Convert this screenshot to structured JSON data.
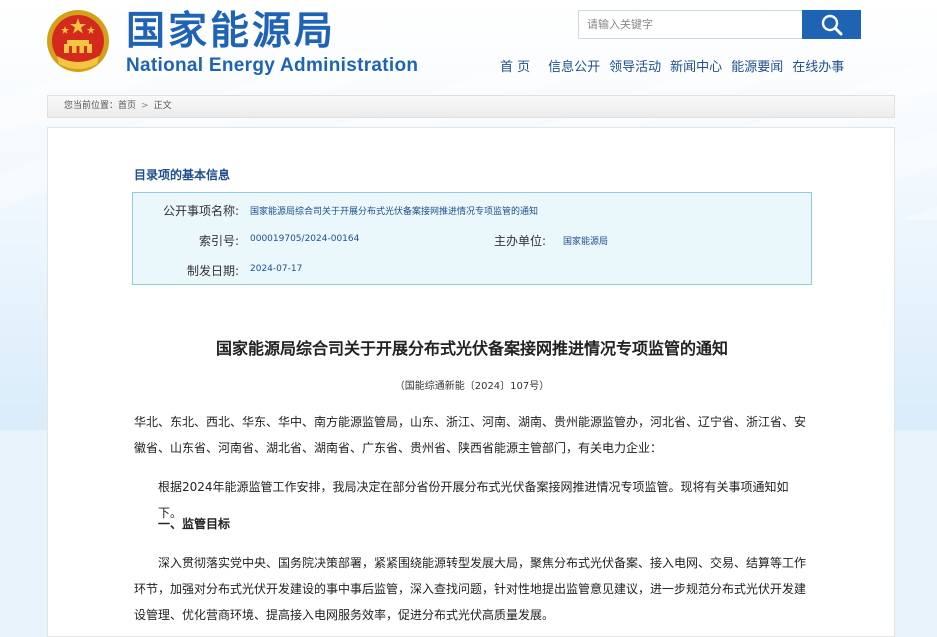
{
  "header": {
    "logo_cn": "国家能源局",
    "logo_en": "National Energy Administration",
    "search_placeholder": "请输入关键字"
  },
  "nav": {
    "items": [
      "首 页",
      "信息公开",
      "领导活动",
      "新闻中心",
      "能源要闻",
      "在线办事"
    ]
  },
  "breadcrumb": {
    "prefix": "您当前位置：",
    "home": "首页",
    "separator": ">",
    "current": "正文"
  },
  "info": {
    "section_title": "目录项的基本信息",
    "labels": {
      "title": "公开事项名称:",
      "index": "索引号:",
      "issuer": "主办单位:",
      "date": "制发日期:"
    },
    "values": {
      "title": "国家能源局综合司关于开展分布式光伏备案接网推进情况专项监管的通知",
      "index": "000019705/2024-00164",
      "issuer": "国家能源局",
      "date": "2024-07-17"
    }
  },
  "document": {
    "title": "国家能源局综合司关于开展分布式光伏备案接网推进情况专项监管的通知",
    "number": "（国能综通新能〔2024〕107号）",
    "addressee_line1": "华北、东北、西北、华东、华中、南方能源监管局，山东、浙江、河南、湖南、贵州能源监管办，河北省、辽宁省、浙江省、安",
    "addressee_line2": "徽省、山东省、河南省、湖北省、湖南省、广东省、贵州省、陕西省能源主管部门，有关电力企业：",
    "intro": "根据2024年能源监管工作安排，我局决定在部分省份开展分布式光伏备案接网推进情况专项监管。现将有关事项通知如下。",
    "section1_heading": "一、监管目标",
    "section1_line1": "深入贯彻落实党中央、国务院决策部署，紧紧围绕能源转型发展大局，聚焦分布式光伏备案、接入电网、交易、结算等工作",
    "section1_line2": "环节，加强对分布式光伏开发建设的事中事后监管，深入查找问题，针对性地提出监管意见建议，进一步规范分布式光伏开发建",
    "section1_line3": "设管理、优化营商环境、提高接入电网服务效率，促进分布式光伏高质量发展。"
  },
  "colors": {
    "brand_blue": "#1f63b5",
    "link_blue": "#1f4f8f",
    "info_box_bg": "#eaf7fb",
    "info_box_border": "#95c9de"
  }
}
